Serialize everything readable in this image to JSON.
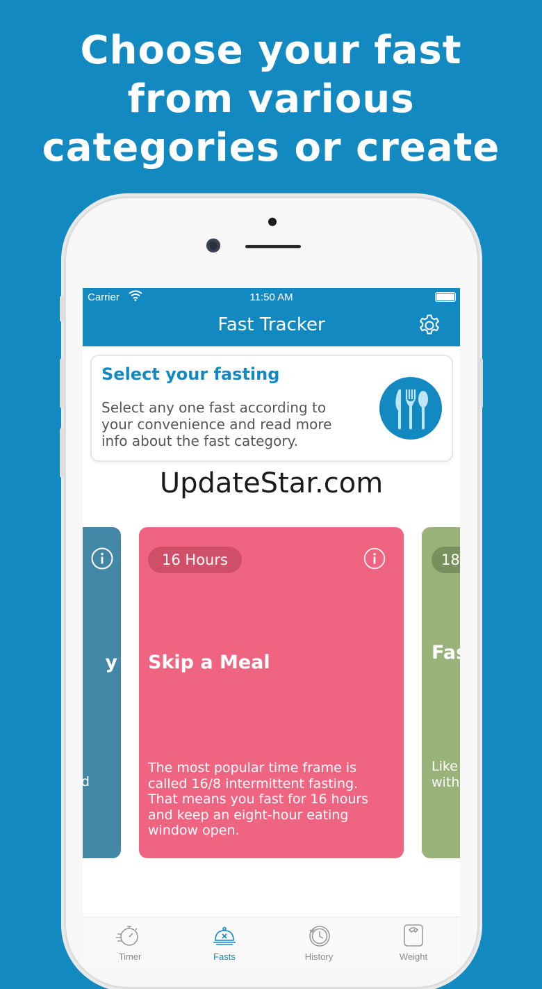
{
  "promo": {
    "headline_line1": "Choose your fast",
    "headline_line2": "from various",
    "headline_line3": "categories or create"
  },
  "status_bar": {
    "carrier": "Carrier",
    "time": "11:50 AM"
  },
  "nav": {
    "title": "Fast Tracker"
  },
  "info_card": {
    "title": "Select your fasting",
    "description": "Select any one fast according to your convenience and read more info about the fast category."
  },
  "watermark": "UpdateStar.com",
  "fast_cards": [
    {
      "hours": "",
      "title": "y",
      "description": "ble. nd",
      "color": "#4387a7"
    },
    {
      "hours": "16 Hours",
      "title": "Skip a Meal",
      "description": "The most popular time frame is called 16/8 intermittent fasting. That means you fast for 16 hours and keep an eight-hour eating window open.",
      "color": "#ef6480"
    },
    {
      "hours": "18",
      "title": "Fas Da",
      "description": "Like abo eati wind with",
      "color": "#98b27a"
    }
  ],
  "tabbar": {
    "items": [
      {
        "label": "Timer",
        "icon": "stopwatch-icon",
        "active": false
      },
      {
        "label": "Fasts",
        "icon": "cloche-icon",
        "active": true
      },
      {
        "label": "History",
        "icon": "history-icon",
        "active": false
      },
      {
        "label": "Weight",
        "icon": "scale-icon",
        "active": false
      }
    ]
  },
  "colors": {
    "brand_blue": "#1389c2",
    "card_pink": "#ef6480",
    "card_green": "#98b27a",
    "card_blue": "#4387a7"
  }
}
